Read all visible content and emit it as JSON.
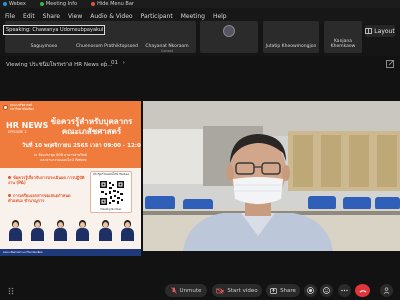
{
  "app": {
    "title": "Webex",
    "tabs": [
      "Meeting Info",
      "Hide Menu Bar"
    ]
  },
  "menu": {
    "items": [
      "File",
      "Edit",
      "Share",
      "View",
      "Audio & Video",
      "Participant",
      "Meeting",
      "Help"
    ]
  },
  "speaking": {
    "text": "Speaking: Chawanya Udomsubpayakul (Host)"
  },
  "participants": [
    {
      "name": "Saguymooo",
      "sub": ""
    },
    {
      "name": "Chuenosom Prathiktopsoed",
      "sub": ""
    },
    {
      "name": "Chayanat Nkoraom",
      "sub": "Cohost"
    },
    {
      "name": "",
      "sub": ""
    },
    {
      "name": "Jutatip Kheowmongjon",
      "sub": ""
    },
    {
      "name": "Kanjana Khemkaew",
      "sub": ""
    }
  ],
  "layout_button": {
    "label": "Layout"
  },
  "viewing": {
    "label": "Viewing ประชนิมโพรพราส HR News ep...",
    "page": "01"
  },
  "slide": {
    "logo_text": "คณะเภสัชศาสตร์ มหาวิทยาลัยมหิดล",
    "hr_news": "HR NEWS",
    "episode": "EPISODE 2",
    "title": "ข้อควรรู้สำหรับบุคลากร คณะเภสัชศาสตร์",
    "date": "วันที่ 10 พฤศจิกายน 2565 เวลา 09:00 - 12:00 น.",
    "sub1": "ณ ห้องประชุม 808 อาคารสายวิทย์",
    "sub2": "และผ่านระบบออนไลน์ Webex",
    "bullet1": "ข้อควรรู้เกี่ยวกับการประเมินผล การปฏิบัติงาน (PA)",
    "bullet2": "การเตรียมเอกสารขอเสนอกำหนด ตำแหน่ง ชำนาญการ",
    "qr_title": "ประชุมร่วมออนไลน์ Webex",
    "qr_foot": "Meeting Number",
    "footer": "คณะเภสัชศาสตร์ มหาวิทยาลัยมหิดล"
  },
  "toolbar": {
    "unmute": "Unmute",
    "start_video": "Start video",
    "share": "Share"
  },
  "colors": {
    "slide_orange": "#ef7b3c",
    "end_call": "#e0353a",
    "webex_blue": "#2c93d8"
  }
}
